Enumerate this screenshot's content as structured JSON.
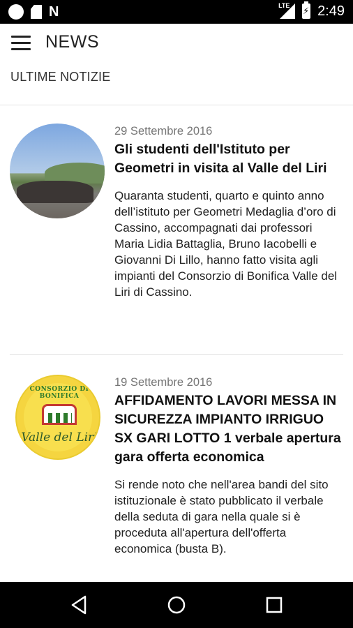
{
  "status_bar": {
    "network": "LTE",
    "time": "2:49"
  },
  "app_bar": {
    "title": "NEWS"
  },
  "section": {
    "label": "ULTIME NOTIZIE"
  },
  "news": [
    {
      "date": "29 Settembre 2016",
      "title": "Gli studenti dell'Istituto per Geometri in visita al Valle del Liri",
      "body": "Quaranta studenti, quarto e quinto anno dell’istituto per Geometri Medaglia d’oro di Cassino, accompagnati dai professori Maria Lidia Battaglia, Bruno Iacobelli e Giovanni Di Lillo, hanno fatto visita agli impianti del Consorzio di Bonifica Valle del Liri di Cassino.",
      "image": "group-photo"
    },
    {
      "date": "19 Settembre 2016",
      "title": "AFFIDAMENTO LAVORI MESSA IN SICUREZZA IMPIANTO IRRIGUO SX GARI LOTTO 1 verbale apertura gara offerta economica",
      "body": "Si rende noto che nell'area bandi del sito istituzionale è stato pubblicato il verbale della seduta di gara nella quale si è proceduta all'apertura dell'offerta economica (busta B).",
      "image": "consorzio-logo",
      "logo": {
        "arc_text": "CONSORZIO DI BONIFICA",
        "name": "Valle del Liri"
      }
    }
  ],
  "nav_bar": {
    "icons": [
      "back-icon",
      "home-icon",
      "recents-icon"
    ]
  },
  "colors": {
    "status_bar": "#000000",
    "logo_yellow": "#f5d540",
    "logo_green": "#2d7a2b",
    "logo_red": "#c43a32"
  }
}
